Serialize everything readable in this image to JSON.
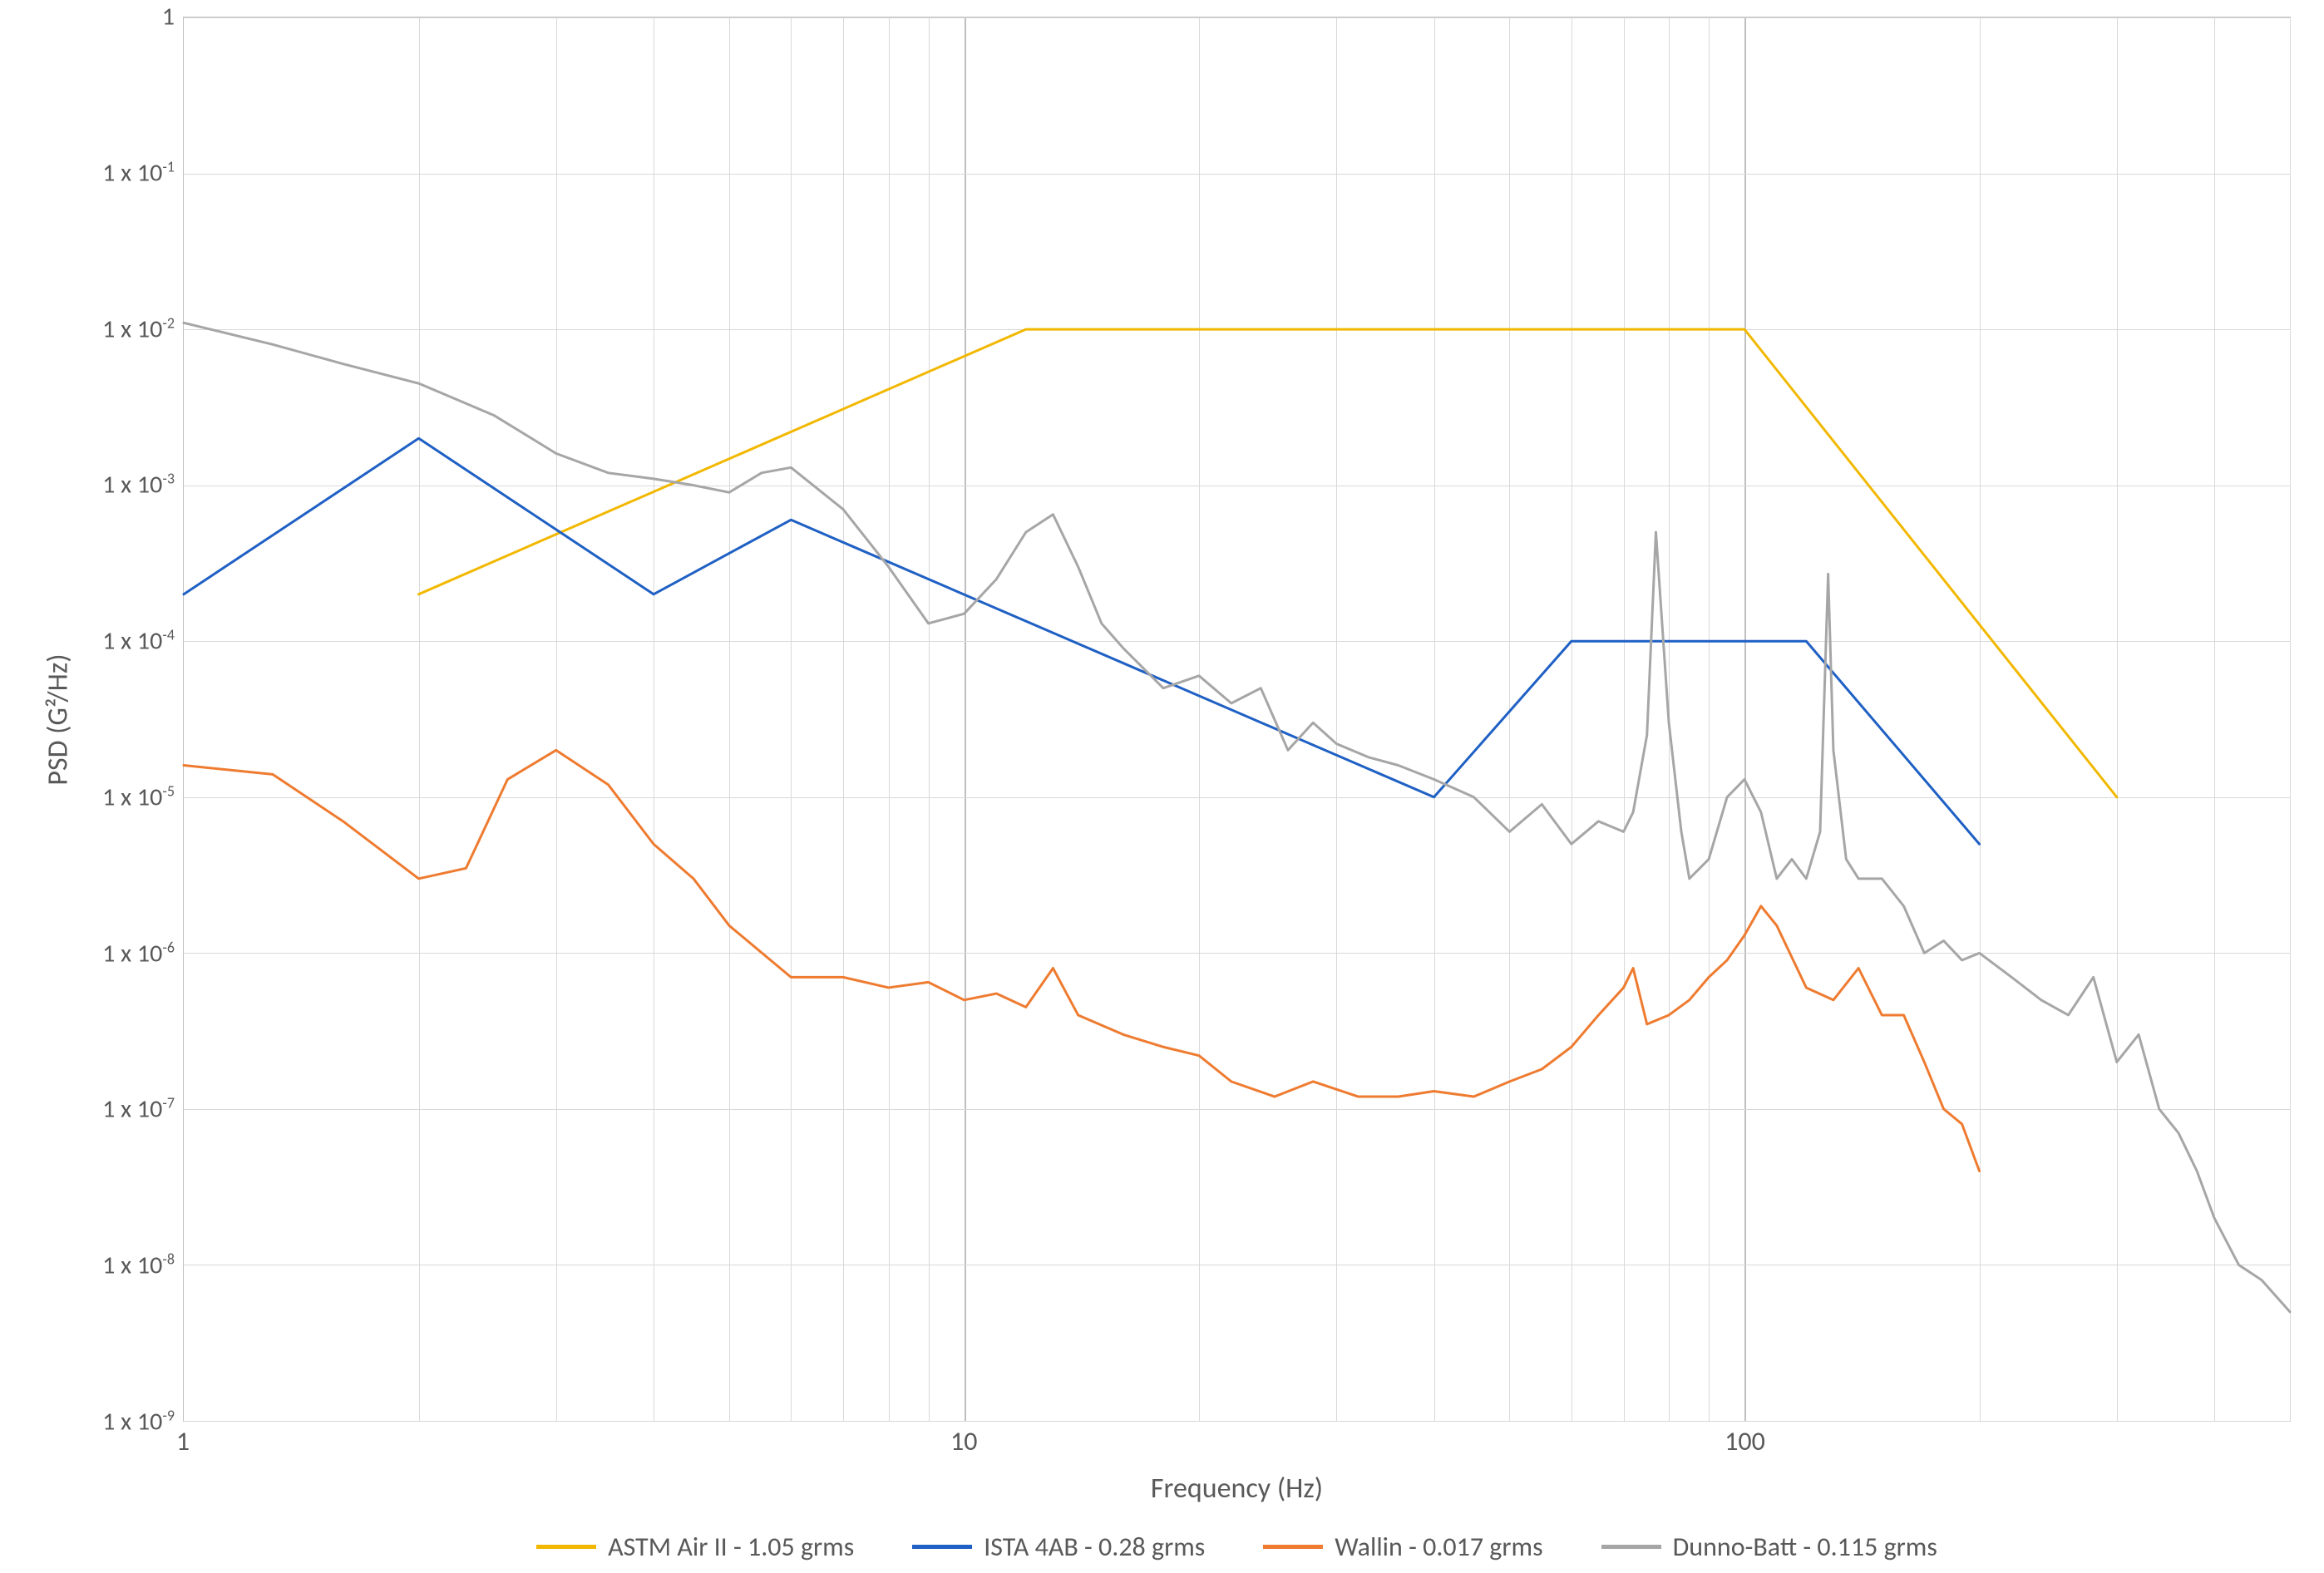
{
  "chart_data": {
    "type": "line",
    "title": "",
    "xlabel": "Frequency (Hz)",
    "ylabel": "PSD (G²/Hz)",
    "x_scale": "log",
    "y_scale": "log",
    "xlim": [
      1,
      500
    ],
    "ylim": [
      1e-09,
      1
    ],
    "x_ticks": [
      1,
      10,
      100
    ],
    "y_ticks": [
      1e-09,
      1e-08,
      1e-07,
      1e-06,
      1e-05,
      0.0001,
      0.001,
      0.01,
      0.1,
      1
    ],
    "y_tick_labels": [
      "1 x 10⁻⁹",
      "1 x 10⁻⁸",
      "1 x 10⁻⁷",
      "1 x 10⁻⁶",
      "1 x 10⁻⁵",
      "1 x 10⁻⁴",
      "1 x 10⁻³",
      "1 x 10⁻²",
      "1 x 10⁻¹",
      "1"
    ],
    "legend_position": "bottom",
    "series": [
      {
        "name": "ASTM Air II - 1.05 grms",
        "color": "#F2B800",
        "x": [
          2,
          12,
          100,
          300
        ],
        "psd": [
          0.0002,
          0.01,
          0.01,
          1e-05
        ]
      },
      {
        "name": "ISTA 4AB - 0.28 grms",
        "color": "#1F60C4",
        "x": [
          1,
          2,
          4,
          6,
          40,
          60,
          120,
          200
        ],
        "psd": [
          0.0002,
          0.002,
          0.0002,
          0.0006,
          1e-05,
          0.0001,
          0.0001,
          5e-06
        ]
      },
      {
        "name": "Wallin - 0.017 grms",
        "color": "#EE7B30",
        "x": [
          1,
          1.3,
          1.6,
          2,
          2.3,
          2.6,
          3,
          3.5,
          4,
          4.5,
          5,
          6,
          7,
          8,
          9,
          10,
          11,
          12,
          13,
          14,
          16,
          18,
          20,
          22,
          25,
          28,
          32,
          36,
          40,
          45,
          50,
          55,
          60,
          65,
          70,
          72,
          75,
          80,
          85,
          90,
          95,
          100,
          105,
          110,
          120,
          130,
          140,
          150,
          160,
          170,
          180,
          190,
          200
        ],
        "psd": [
          1.6e-05,
          1.4e-05,
          7e-06,
          3e-06,
          3.5e-06,
          1.3e-05,
          2e-05,
          1.2e-05,
          5e-06,
          3e-06,
          1.5e-06,
          7e-07,
          7e-07,
          6e-07,
          6.5e-07,
          5e-07,
          5.5e-07,
          4.5e-07,
          8e-07,
          4e-07,
          3e-07,
          2.5e-07,
          2.2e-07,
          1.5e-07,
          1.2e-07,
          1.5e-07,
          1.2e-07,
          1.2e-07,
          1.3e-07,
          1.2e-07,
          1.5e-07,
          1.8e-07,
          2.5e-07,
          4e-07,
          6e-07,
          8e-07,
          3.5e-07,
          4e-07,
          5e-07,
          7e-07,
          9e-07,
          1.3e-06,
          2e-06,
          1.5e-06,
          6e-07,
          5e-07,
          8e-07,
          4e-07,
          4e-07,
          2e-07,
          1e-07,
          8e-08,
          4e-08
        ]
      },
      {
        "name": "Dunno-Batt - 0.115 grms",
        "color": "#A6A6A6",
        "x": [
          1,
          1.3,
          1.6,
          2,
          2.5,
          3,
          3.5,
          4,
          4.5,
          5,
          5.5,
          6,
          7,
          8,
          9,
          10,
          11,
          12,
          13,
          14,
          15,
          16,
          18,
          20,
          22,
          24,
          26,
          28,
          30,
          33,
          36,
          40,
          45,
          50,
          55,
          60,
          65,
          70,
          72,
          75,
          77,
          80,
          83,
          85,
          90,
          95,
          100,
          105,
          110,
          115,
          120,
          125,
          128,
          130,
          135,
          140,
          150,
          160,
          170,
          180,
          190,
          200,
          220,
          240,
          260,
          280,
          300,
          320,
          340,
          360,
          380,
          400,
          430,
          460,
          500
        ],
        "psd": [
          0.011,
          0.008,
          0.006,
          0.0045,
          0.0028,
          0.0016,
          0.0012,
          0.0011,
          0.001,
          0.0009,
          0.0012,
          0.0013,
          0.0007,
          0.0003,
          0.00013,
          0.00015,
          0.00025,
          0.0005,
          0.00065,
          0.0003,
          0.00013,
          9e-05,
          5e-05,
          6e-05,
          4e-05,
          5e-05,
          2e-05,
          3e-05,
          2.2e-05,
          1.8e-05,
          1.6e-05,
          1.3e-05,
          1e-05,
          6e-06,
          9e-06,
          5e-06,
          7e-06,
          6e-06,
          8e-06,
          2.5e-05,
          0.0005,
          3e-05,
          6e-06,
          3e-06,
          4e-06,
          1e-05,
          1.3e-05,
          8e-06,
          3e-06,
          4e-06,
          3e-06,
          6e-06,
          0.00027,
          2e-05,
          4e-06,
          3e-06,
          3e-06,
          2e-06,
          1e-06,
          1.2e-06,
          9e-07,
          1e-06,
          7e-07,
          5e-07,
          4e-07,
          7e-07,
          2e-07,
          3e-07,
          1e-07,
          7e-08,
          4e-08,
          2e-08,
          1e-08,
          8e-09,
          5e-09
        ]
      }
    ]
  }
}
